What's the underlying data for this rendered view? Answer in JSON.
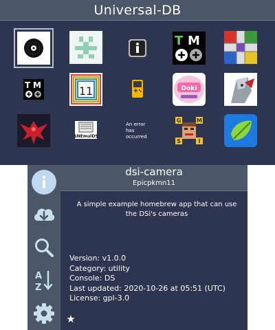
{
  "top_screen": {
    "title": "Universal-DB",
    "grid": {
      "rows": [
        [
          {
            "name": "vinyl-disc-icon",
            "selected": true
          },
          {
            "name": "green-pixel-glyph-icon"
          },
          {
            "name": "info-box-icon"
          },
          {
            "name": "tm-plus-icon",
            "label": "TM"
          },
          {
            "name": "ludo-board-icon"
          }
        ],
        [
          {
            "name": "tm-plus-small-icon",
            "label": "TM"
          },
          {
            "name": "rainbow-calendar-icon",
            "label": "11"
          },
          {
            "name": "gameboy-color-icon"
          },
          {
            "name": "anime-logo-icon"
          },
          {
            "name": "armored-knight-icon"
          }
        ],
        [
          {
            "name": "red-phoenix-icon"
          },
          {
            "name": "snemulds-icon",
            "label": "SNEmulDS"
          },
          {
            "name": "error-placeholder-icon",
            "label": "An error has occurred"
          },
          {
            "name": "pixel-face-puzzle-icon"
          },
          {
            "name": "leaf-app-icon"
          }
        ]
      ]
    }
  },
  "bottom_screen": {
    "sidebar": [
      {
        "name": "info-tab-icon",
        "active": true
      },
      {
        "name": "download-cloud-tab-icon"
      },
      {
        "name": "search-tab-icon"
      },
      {
        "name": "sort-az-tab-icon"
      },
      {
        "name": "settings-gear-tab-icon"
      }
    ],
    "app": {
      "title": "dsi-camera",
      "author": "Epicpkmn11",
      "description": "A simple example homebrew app that can use the DSi's cameras",
      "details": {
        "version": "Version: v1.0.0",
        "category": "Category: utility",
        "console": "Console: DS",
        "last_updated": "Last updated: 2020-10-26 at 05:51 (UTC)",
        "license": "License: gpl-3.0"
      }
    },
    "star_button": "★"
  },
  "colors": {
    "background": "#2d3550",
    "bar": "#4b5668",
    "accent": "#bfd9f1",
    "icon_tint": "#c9def1"
  }
}
